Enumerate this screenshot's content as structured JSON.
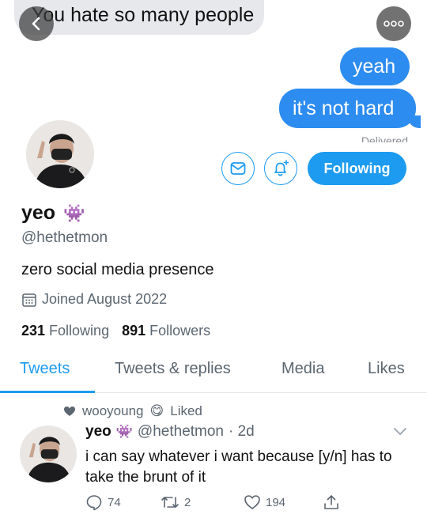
{
  "chat": {
    "incoming": "You hate so many people",
    "outgoing": [
      "yeah",
      "it's not hard"
    ],
    "status": "Delivered"
  },
  "profile": {
    "display_name": "yeo",
    "name_emoji": "👾",
    "handle": "@hethetmon",
    "bio": "zero social media presence",
    "joined": "Joined August 2022",
    "following_count": "231",
    "following_label": "Following",
    "followers_count": "891",
    "followers_label": "Followers",
    "follow_button": "Following"
  },
  "tabs": [
    {
      "label": "Tweets",
      "active": true
    },
    {
      "label": "Tweets & replies",
      "active": false
    },
    {
      "label": "Media",
      "active": false
    },
    {
      "label": "Likes",
      "active": false
    }
  ],
  "tweet": {
    "liked_by": "wooyoung",
    "liked_by_emoji": "😋",
    "liked_label": "Liked",
    "name": "yeo",
    "name_emoji": "👾",
    "handle": "@hethetmon",
    "time": "· 2d",
    "text": "i can say whatever i want because [y/n] has to take the brunt of it",
    "replies": "74",
    "retweets": "2",
    "likes": "194"
  },
  "icons": {
    "back": "chevron-left-icon",
    "more": "more-dots-icon",
    "message": "envelope-icon",
    "notify": "bell-plus-icon",
    "calendar": "calendar-icon",
    "heart": "heart-icon",
    "caret": "chevron-down-icon",
    "reply": "reply-icon",
    "retweet": "retweet-icon",
    "like": "like-icon",
    "share": "share-icon"
  },
  "colors": {
    "accent": "#1d9bf0",
    "imessage_blue": "#2d8cf0",
    "muted": "#5b6670"
  }
}
